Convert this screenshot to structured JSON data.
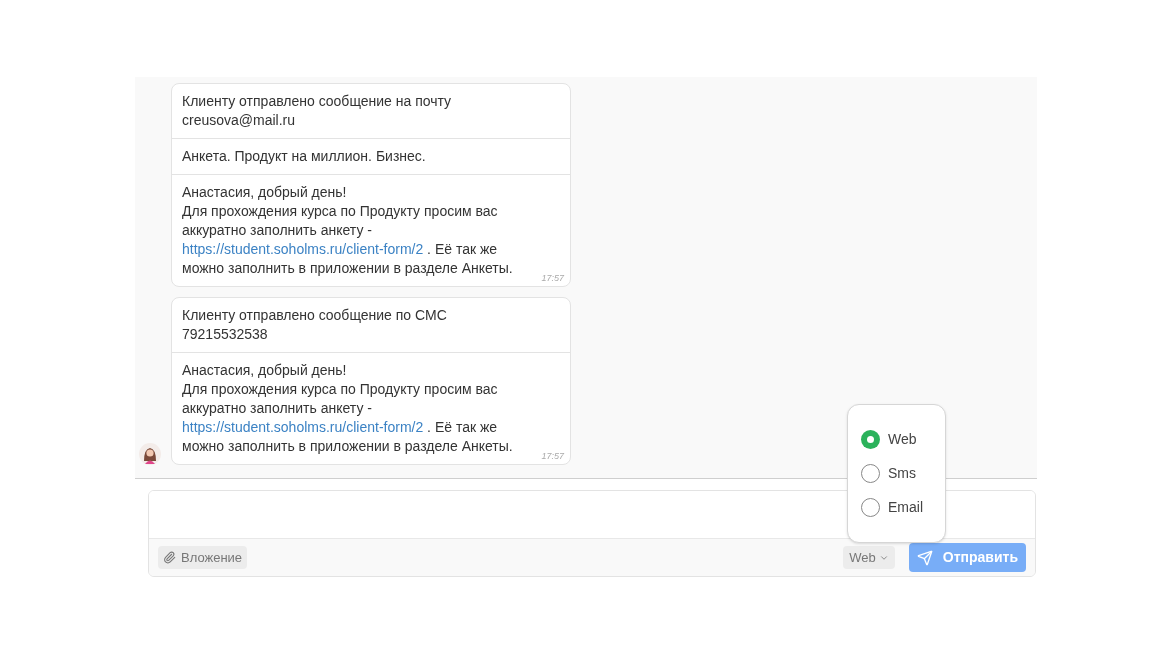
{
  "messages": [
    {
      "time": "17:57",
      "avatar": false,
      "sections": [
        {
          "text": "Клиенту отправлено сообщение на почту\ncreusova@mail.ru"
        },
        {
          "text": "Анкета. Продукт на миллион. Бизнес."
        },
        {
          "text": "Анастасия, добрый день!\nДля прохождения курса по Продукту просим вас\nаккуратно заполнить анкету -\n",
          "link": "https://student.soholms.ru/client-form/2",
          "after": " . Её так же\nможно заполнить в приложении в разделе Анкеты."
        }
      ]
    },
    {
      "time": "17:57",
      "avatar": true,
      "sections": [
        {
          "text": "Клиенту отправлено сообщение по СМС\n79215532538"
        },
        {
          "text": "Анастасия, добрый день!\nДля прохождения курса по Продукту просим вас\nаккуратно заполнить анкету -\n",
          "link": "https://student.soholms.ru/client-form/2",
          "after": " . Её так же\nможно заполнить в приложении в разделе Анкеты."
        }
      ]
    }
  ],
  "composer": {
    "attach_label": "Вложение",
    "channel": "Web",
    "send_label": "Отправить"
  },
  "channel_menu": {
    "open": true,
    "options": [
      {
        "label": "Web",
        "selected": true
      },
      {
        "label": "Sms",
        "selected": false
      },
      {
        "label": "Email",
        "selected": false
      }
    ]
  }
}
